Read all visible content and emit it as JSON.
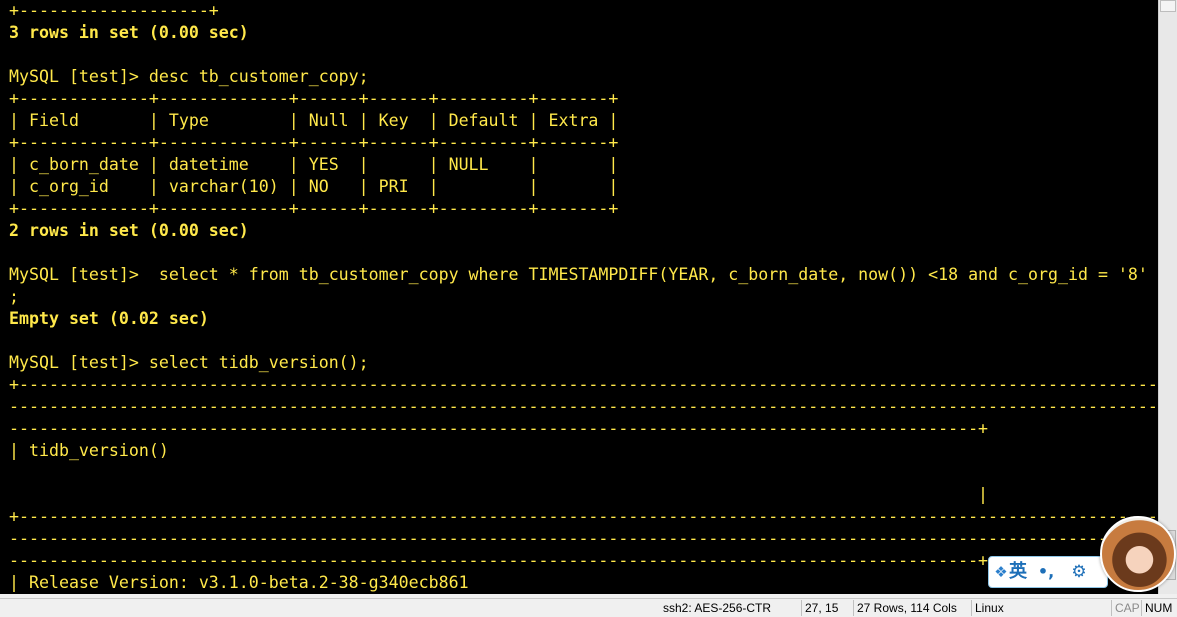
{
  "terminal": {
    "lines": [
      "+-------------------+",
      "3 rows in set (0.00 sec)",
      "",
      "MySQL [test]> desc tb_customer_copy;",
      "+-------------+-------------+------+------+---------+-------+",
      "| Field       | Type        | Null | Key  | Default | Extra |",
      "+-------------+-------------+------+------+---------+-------+",
      "| c_born_date | datetime    | YES  |      | NULL    |       |",
      "| c_org_id    | varchar(10) | NO   | PRI  |         |       |",
      "+-------------+-------------+------+------+---------+-------+",
      "2 rows in set (0.00 sec)",
      "",
      "MySQL [test]>  select * from tb_customer_copy where TIMESTAMPDIFF(YEAR, c_born_date, now()) <18 and c_org_id = '8'",
      ";",
      "Empty set (0.02 sec)",
      "",
      "MySQL [test]> select tidb_version();",
      "+--------------------------------------------------------------------------------------------------------------------",
      "--------------------------------------------------------------------------------------------------------------------",
      "-------------------------------------------------------------------------------------------------+",
      "| tidb_version()",
      "",
      "                                                                                                 |",
      "+--------------------------------------------------------------------------------------------------------------------",
      "--------------------------------------------------------------------------------------------------------------------",
      "-------------------------------------------------------------------------------------------------+",
      "| Release Version: v3.1.0-beta.2-38-g340ecb861"
    ],
    "bold_lines": [
      1,
      10,
      14
    ],
    "text_color": "#ffe84a",
    "background": "#000000"
  },
  "statusbar": {
    "cipher": "ssh2: AES-256-CTR",
    "cursor": "27,  15",
    "size": "27 Rows, 114 Cols",
    "os": "Linux",
    "caps": "CAP",
    "num": "NUM"
  },
  "ime": {
    "logo_icon": "ime-logo-icon",
    "lang": "英",
    "punct": "•,",
    "gear_icon": "gear-icon",
    "gear": "⚙"
  }
}
